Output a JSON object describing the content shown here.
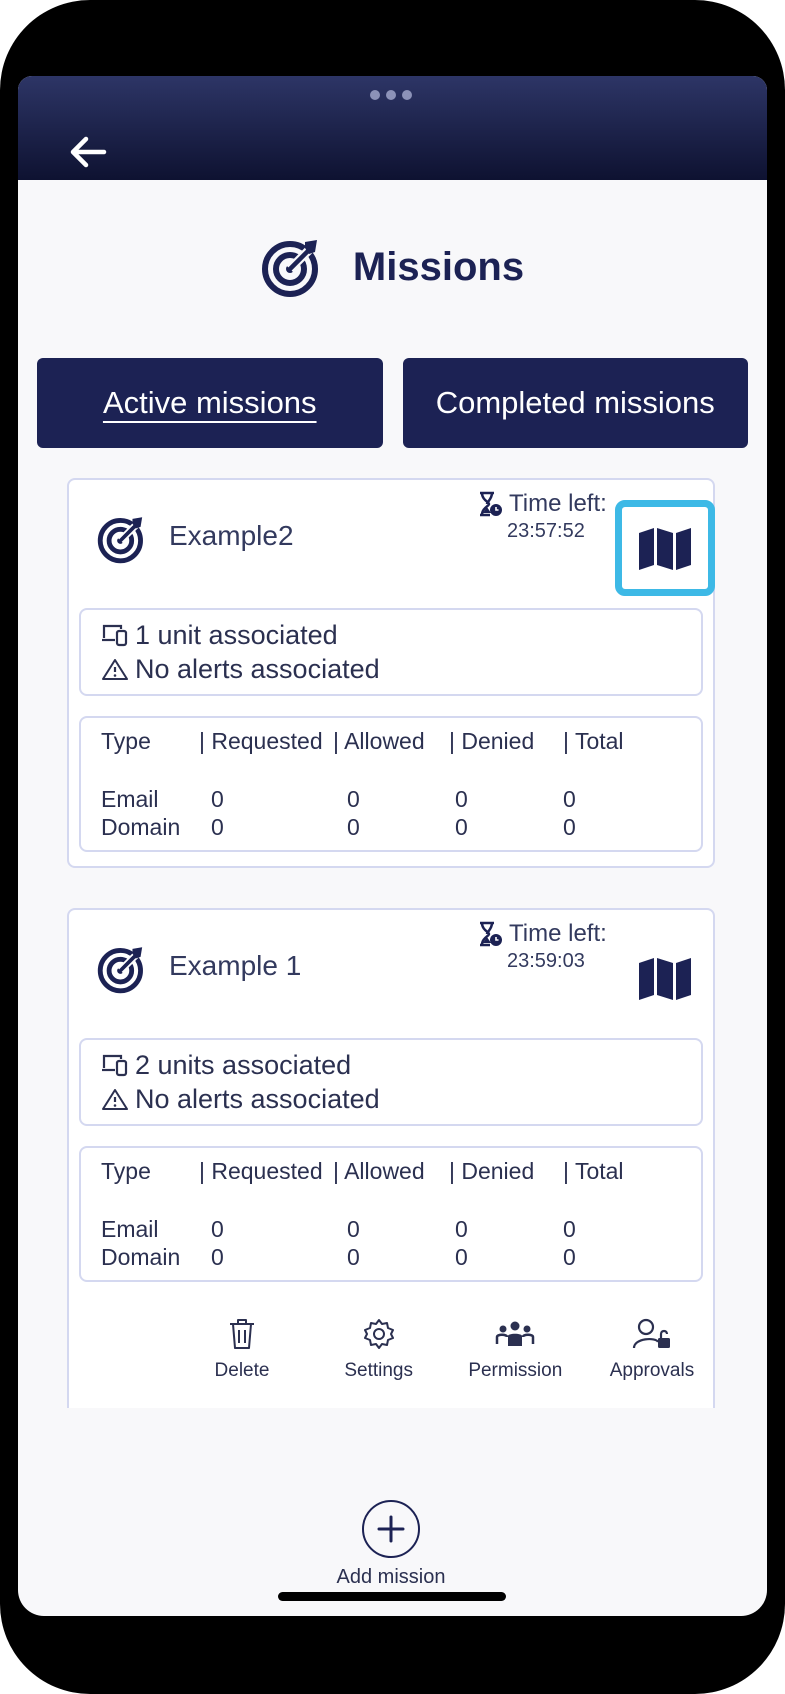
{
  "header": {
    "title": "Missions"
  },
  "tabs": {
    "active": "Active missions",
    "completed": "Completed missions"
  },
  "missions": [
    {
      "name": "Example2",
      "time_left_label": "Time left:",
      "time_left_value": "23:57:52",
      "units": "1 unit associated",
      "alerts": "No alerts associated",
      "table": {
        "headers": [
          "Type",
          "| Requested",
          "| Allowed",
          "| Denied",
          "| Total"
        ],
        "rows": [
          [
            "Email",
            "0",
            "0",
            "0",
            "0"
          ],
          [
            "Domain",
            "0",
            "0",
            "0",
            "0"
          ]
        ]
      }
    },
    {
      "name": "Example 1",
      "time_left_label": "Time left:",
      "time_left_value": "23:59:03",
      "units": "2 units associated",
      "alerts": "No alerts associated",
      "table": {
        "headers": [
          "Type",
          "| Requested",
          "| Allowed",
          "| Denied",
          "| Total"
        ],
        "rows": [
          [
            "Email",
            "0",
            "0",
            "0",
            "0"
          ],
          [
            "Domain",
            "0",
            "0",
            "0",
            "0"
          ]
        ]
      },
      "actions": [
        "Delete",
        "Settings",
        "Permission",
        "Approvals"
      ]
    }
  ],
  "add_mission": "Add mission",
  "colors": {
    "navy": "#1c2254",
    "highlight": "#3db9e6",
    "border": "#d4d8f0"
  },
  "icons": [
    "back-arrow-icon",
    "target-icon",
    "hourglass-icon",
    "map-icon",
    "devices-icon",
    "warning-icon",
    "trash-icon",
    "gear-icon",
    "people-icon",
    "user-lock-icon",
    "plus-icon"
  ]
}
